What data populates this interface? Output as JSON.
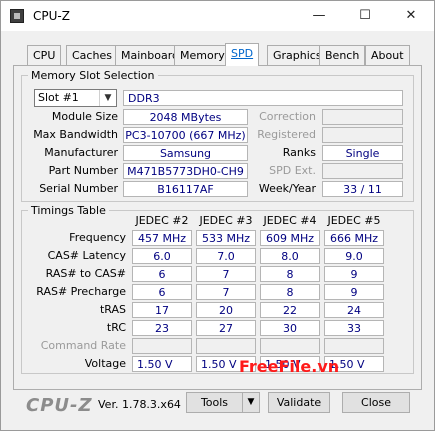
{
  "window": {
    "title": "CPU-Z",
    "minimize": "—",
    "maximize": "☐",
    "close": "✕"
  },
  "tabs": [
    "CPU",
    "Caches",
    "Mainboard",
    "Memory",
    "SPD",
    "Graphics",
    "Bench",
    "About"
  ],
  "active_tab": "SPD",
  "slot": {
    "section_title": "Memory Slot Selection",
    "slot_selected": "Slot #1",
    "type": "DDR3",
    "module_size_label": "Module Size",
    "module_size": "2048 MBytes",
    "max_bandwidth_label": "Max Bandwidth",
    "max_bandwidth": "PC3-10700 (667 MHz)",
    "manufacturer_label": "Manufacturer",
    "manufacturer": "Samsung",
    "part_number_label": "Part Number",
    "part_number": "M471B5773DH0-CH9",
    "serial_number_label": "Serial Number",
    "serial_number": "B16117AF",
    "correction_label": "Correction",
    "correction": "",
    "registered_label": "Registered",
    "registered": "",
    "ranks_label": "Ranks",
    "ranks": "Single",
    "spd_ext_label": "SPD Ext.",
    "spd_ext": "",
    "week_year_label": "Week/Year",
    "week_year": "33 / 11"
  },
  "timings": {
    "section_title": "Timings Table",
    "columns": [
      "JEDEC #2",
      "JEDEC #3",
      "JEDEC #4",
      "JEDEC #5"
    ],
    "rows": [
      {
        "label": "Frequency",
        "values": [
          "457 MHz",
          "533 MHz",
          "609 MHz",
          "666 MHz"
        ]
      },
      {
        "label": "CAS# Latency",
        "values": [
          "6.0",
          "7.0",
          "8.0",
          "9.0"
        ]
      },
      {
        "label": "RAS# to CAS#",
        "values": [
          "6",
          "7",
          "8",
          "9"
        ]
      },
      {
        "label": "RAS# Precharge",
        "values": [
          "6",
          "7",
          "8",
          "9"
        ]
      },
      {
        "label": "tRAS",
        "values": [
          "17",
          "20",
          "22",
          "24"
        ]
      },
      {
        "label": "tRC",
        "values": [
          "23",
          "27",
          "30",
          "33"
        ]
      },
      {
        "label": "Command Rate",
        "values": [
          "",
          "",
          "",
          ""
        ]
      },
      {
        "label": "Voltage",
        "values": [
          "1.50 V",
          "1.50 V",
          "1.50 V",
          "1.50 V"
        ]
      }
    ]
  },
  "footer": {
    "logo": "CPU-Z",
    "version": "Ver. 1.78.3.x64",
    "tools_label": "Tools",
    "validate_label": "Validate",
    "close_label": "Close"
  },
  "watermark": "FreeFile.vn",
  "colors": {
    "value_text": "#000080",
    "active_tab_text": "#0066cc",
    "watermark": "#ff1a1a"
  }
}
